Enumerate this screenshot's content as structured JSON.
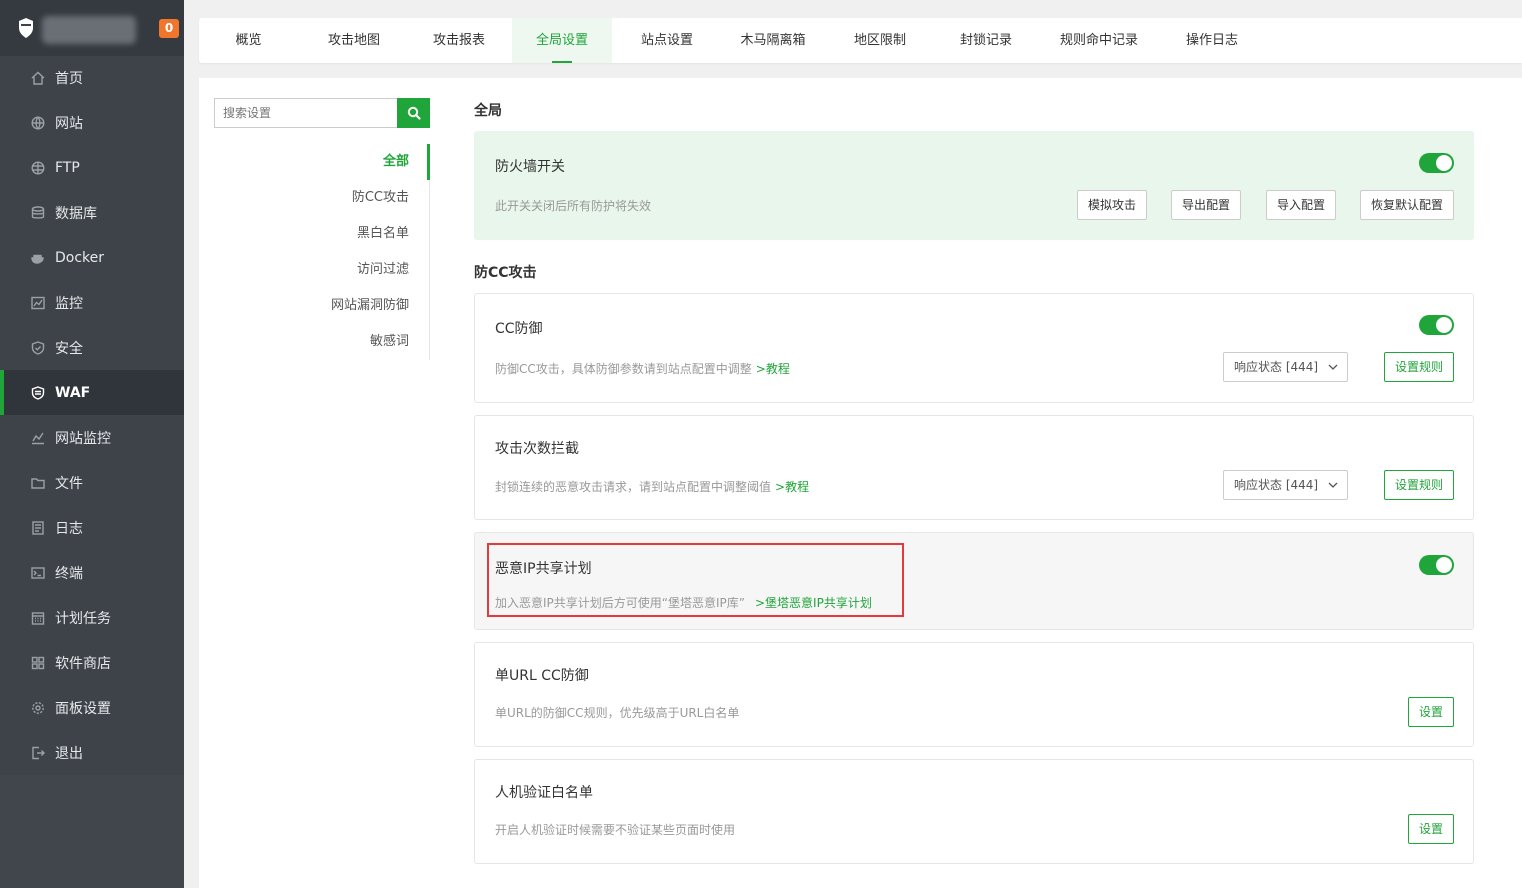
{
  "sidebar": {
    "badge": "0",
    "items": [
      {
        "label": "首页",
        "icon": "home-icon"
      },
      {
        "label": "网站",
        "icon": "globe-icon"
      },
      {
        "label": "FTP",
        "icon": "ftp-globe-icon"
      },
      {
        "label": "数据库",
        "icon": "database-icon"
      },
      {
        "label": "Docker",
        "icon": "docker-icon"
      },
      {
        "label": "监控",
        "icon": "monitor-icon"
      },
      {
        "label": "安全",
        "icon": "shield-icon"
      },
      {
        "label": "WAF",
        "icon": "waf-shield-icon",
        "active": true
      },
      {
        "label": "网站监控",
        "icon": "chart-icon"
      },
      {
        "label": "文件",
        "icon": "folder-icon"
      },
      {
        "label": "日志",
        "icon": "log-icon"
      },
      {
        "label": "终端",
        "icon": "terminal-icon"
      },
      {
        "label": "计划任务",
        "icon": "calendar-icon"
      },
      {
        "label": "软件商店",
        "icon": "grid-icon"
      },
      {
        "label": "面板设置",
        "icon": "gear-icon"
      },
      {
        "label": "退出",
        "icon": "logout-icon"
      }
    ]
  },
  "tabs": [
    "概览",
    "攻击地图",
    "攻击报表",
    "全局设置",
    "站点设置",
    "木马隔离箱",
    "地区限制",
    "封锁记录",
    "规则命中记录",
    "操作日志"
  ],
  "active_tab": "全局设置",
  "search": {
    "placeholder": "搜索设置"
  },
  "categories": [
    "全部",
    "防CC攻击",
    "黑白名单",
    "访问过滤",
    "网站漏洞防御",
    "敏感词"
  ],
  "sections": {
    "global_title": "全局",
    "cc_title": "防CC攻击"
  },
  "cards": {
    "firewall": {
      "title": "防火墙开关",
      "desc": "此开关关闭后所有防护将失效",
      "enabled": true,
      "buttons": [
        "模拟攻击",
        "导出配置",
        "导入配置",
        "恢复默认配置"
      ]
    },
    "cc": {
      "title": "CC防御",
      "desc": "防御CC攻击，具体防御参数请到站点配置中调整",
      "link": ">教程",
      "select": "响应状态 [444]",
      "button": "设置规则",
      "enabled": true
    },
    "attack_count": {
      "title": "攻击次数拦截",
      "desc": "封锁连续的恶意攻击请求，请到站点配置中调整阈值",
      "link": ">教程",
      "select": "响应状态 [444]",
      "button": "设置规则"
    },
    "malicious_ip": {
      "title": "恶意IP共享计划",
      "desc": "加入恶意IP共享计划后方可使用“堡塔恶意IP库”",
      "link": ">堡塔恶意IP共享计划",
      "enabled": true
    },
    "single_url": {
      "title": "单URL CC防御",
      "desc": "单URL的防御CC规则，优先级高于URL白名单",
      "button": "设置"
    },
    "captcha_whitelist": {
      "title": "人机验证白名单",
      "desc": "开启人机验证时候需要不验证某些页面时使用",
      "button": "设置"
    }
  },
  "colors": {
    "accent": "#20a53a",
    "sidebar": "#3e434a",
    "highlight": "#e23b3b"
  }
}
